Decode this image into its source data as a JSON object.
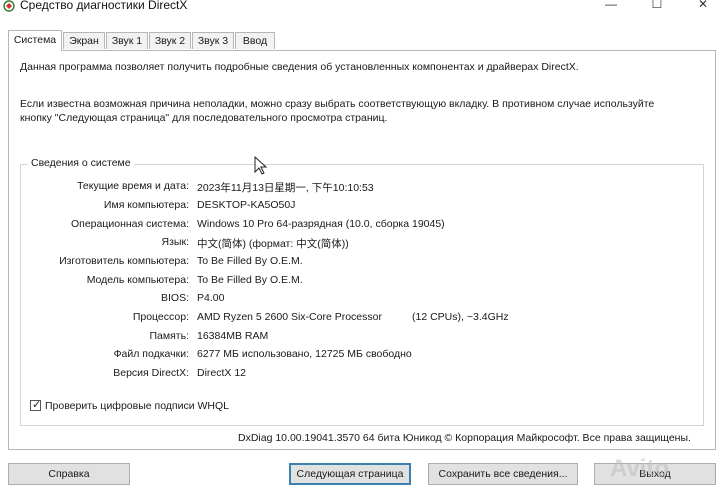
{
  "window": {
    "title": "Средство диагностики DirectX",
    "icon": "directx-app-icon",
    "controls": {
      "minimize": "—",
      "maximize": "☐",
      "close": "✕"
    }
  },
  "tabs": [
    {
      "label": "Система",
      "active": true
    },
    {
      "label": "Экран",
      "active": false
    },
    {
      "label": "Звук 1",
      "active": false
    },
    {
      "label": "Звук 2",
      "active": false
    },
    {
      "label": "Звук 3",
      "active": false
    },
    {
      "label": "Ввод",
      "active": false
    }
  ],
  "intro": {
    "line1": "Данная программа позволяет получить подробные сведения об установленных компонентах и драйверах DirectX.",
    "line2": "Если известна возможная причина неполадки, можно сразу выбрать соответствующую вкладку. В противном случае используйте кнопку \"Следующая страница\" для последовательного просмотра страниц."
  },
  "system_info": {
    "legend": "Сведения о системе",
    "rows": [
      {
        "label": "Текущие время и дата:",
        "value": "2023年11月13日星期一, 下午10:10:53"
      },
      {
        "label": "Имя компьютера:",
        "value": "DESKTOP-KA5O50J"
      },
      {
        "label": "Операционная система:",
        "value": "Windows 10 Pro 64-разрядная (10.0, сборка 19045)"
      },
      {
        "label": "Язык:",
        "value": "中文(简体) (формат: 中文(简体))"
      },
      {
        "label": "Изготовитель компьютера:",
        "value": "To Be Filled By O.E.M."
      },
      {
        "label": "Модель компьютера:",
        "value": "To Be Filled By O.E.M."
      },
      {
        "label": "BIOS:",
        "value": "P4.00"
      },
      {
        "label": "Процессор:",
        "value": "AMD Ryzen 5 2600 Six-Core Processor"
      },
      {
        "label": "Память:",
        "value": "16384MB RAM"
      },
      {
        "label": "Файл подкачки:",
        "value": "6277 МБ использовано, 12725 МБ свободно"
      },
      {
        "label": "Версия DirectX:",
        "value": "DirectX 12"
      }
    ],
    "cpu_extra": "(12 CPUs), ~3.4GHz"
  },
  "whql": {
    "label": "Проверить цифровые подписи WHQL",
    "checked": true
  },
  "footer": "DxDiag 10.00.19041.3570 64 бита Юникод © Корпорация Майкрософт. Все права защищены.",
  "buttons": {
    "help": "Справка",
    "next": "Следующая страница",
    "save": "Сохранить все сведения...",
    "exit": "Выход"
  },
  "watermark": "Avito"
}
